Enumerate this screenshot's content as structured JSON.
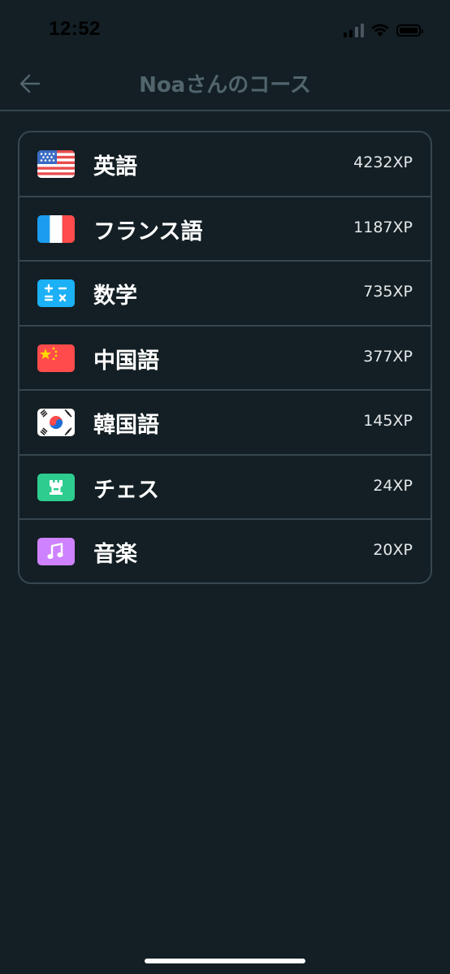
{
  "status_bar": {
    "time": "12:52"
  },
  "header": {
    "title": "Noaさんのコース",
    "back_icon": "arrow-left-icon"
  },
  "courses": [
    {
      "name": "英語",
      "xp": "4232XP",
      "icon": "us-flag-icon"
    },
    {
      "name": "フランス語",
      "xp": "1187XP",
      "icon": "france-flag-icon"
    },
    {
      "name": "数学",
      "xp": "735XP",
      "icon": "math-icon"
    },
    {
      "name": "中国語",
      "xp": "377XP",
      "icon": "china-flag-icon"
    },
    {
      "name": "韓国語",
      "xp": "145XP",
      "icon": "korea-flag-icon"
    },
    {
      "name": "チェス",
      "xp": "24XP",
      "icon": "chess-icon"
    },
    {
      "name": "音楽",
      "xp": "20XP",
      "icon": "music-icon"
    }
  ],
  "colors": {
    "background": "#131f24",
    "border": "#37464f",
    "title": "#52656d",
    "math": "#1cb0f6",
    "chess": "#2ecc8f",
    "music": "#ce82ff"
  }
}
